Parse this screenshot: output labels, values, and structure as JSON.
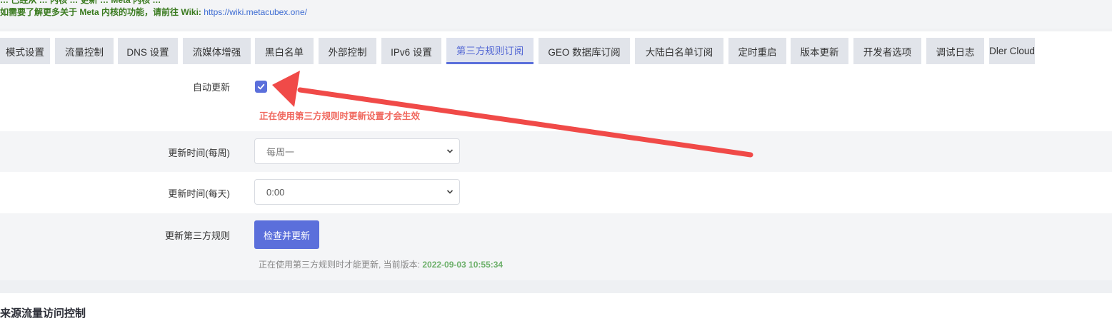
{
  "notice": {
    "line1": "… 已经从 … 内核 … 更新 … Meta 内核 …",
    "line2_prefix": "如需要了解更多关于 Meta 内核的功能，请前往 Wiki: ",
    "line2_link": "https://wiki.metacubex.one/"
  },
  "tabs": [
    "模式设置",
    "流量控制",
    "DNS 设置",
    "流媒体增强",
    "黑白名单",
    "外部控制",
    "IPv6 设置",
    "第三方规则订阅",
    "GEO 数据库订阅",
    "大陆白名单订阅",
    "定时重启",
    "版本更新",
    "开发者选项",
    "调试日志",
    "Dler Cloud"
  ],
  "active_tab": "第三方规则订阅",
  "form": {
    "auto_update_label": "自动更新",
    "auto_update_checked": true,
    "auto_update_warning": "正在使用第三方规则时更新设置才会生效",
    "weekly_label": "更新时间(每周)",
    "weekly_value": "每周一",
    "daily_label": "更新时间(每天)",
    "daily_value": "0:00",
    "update_rules_label": "更新第三方规则",
    "check_button": "检查并更新",
    "version_prefix": "正在使用第三方规则时才能更新, 当前版本: ",
    "version_value": "2022-09-03 10:55:34"
  },
  "section_title": "来源流量访问控制",
  "colors": {
    "accent": "#5b6fdb",
    "warning": "#f0685e",
    "version": "#6db06b",
    "arrow": "#f04a48"
  }
}
